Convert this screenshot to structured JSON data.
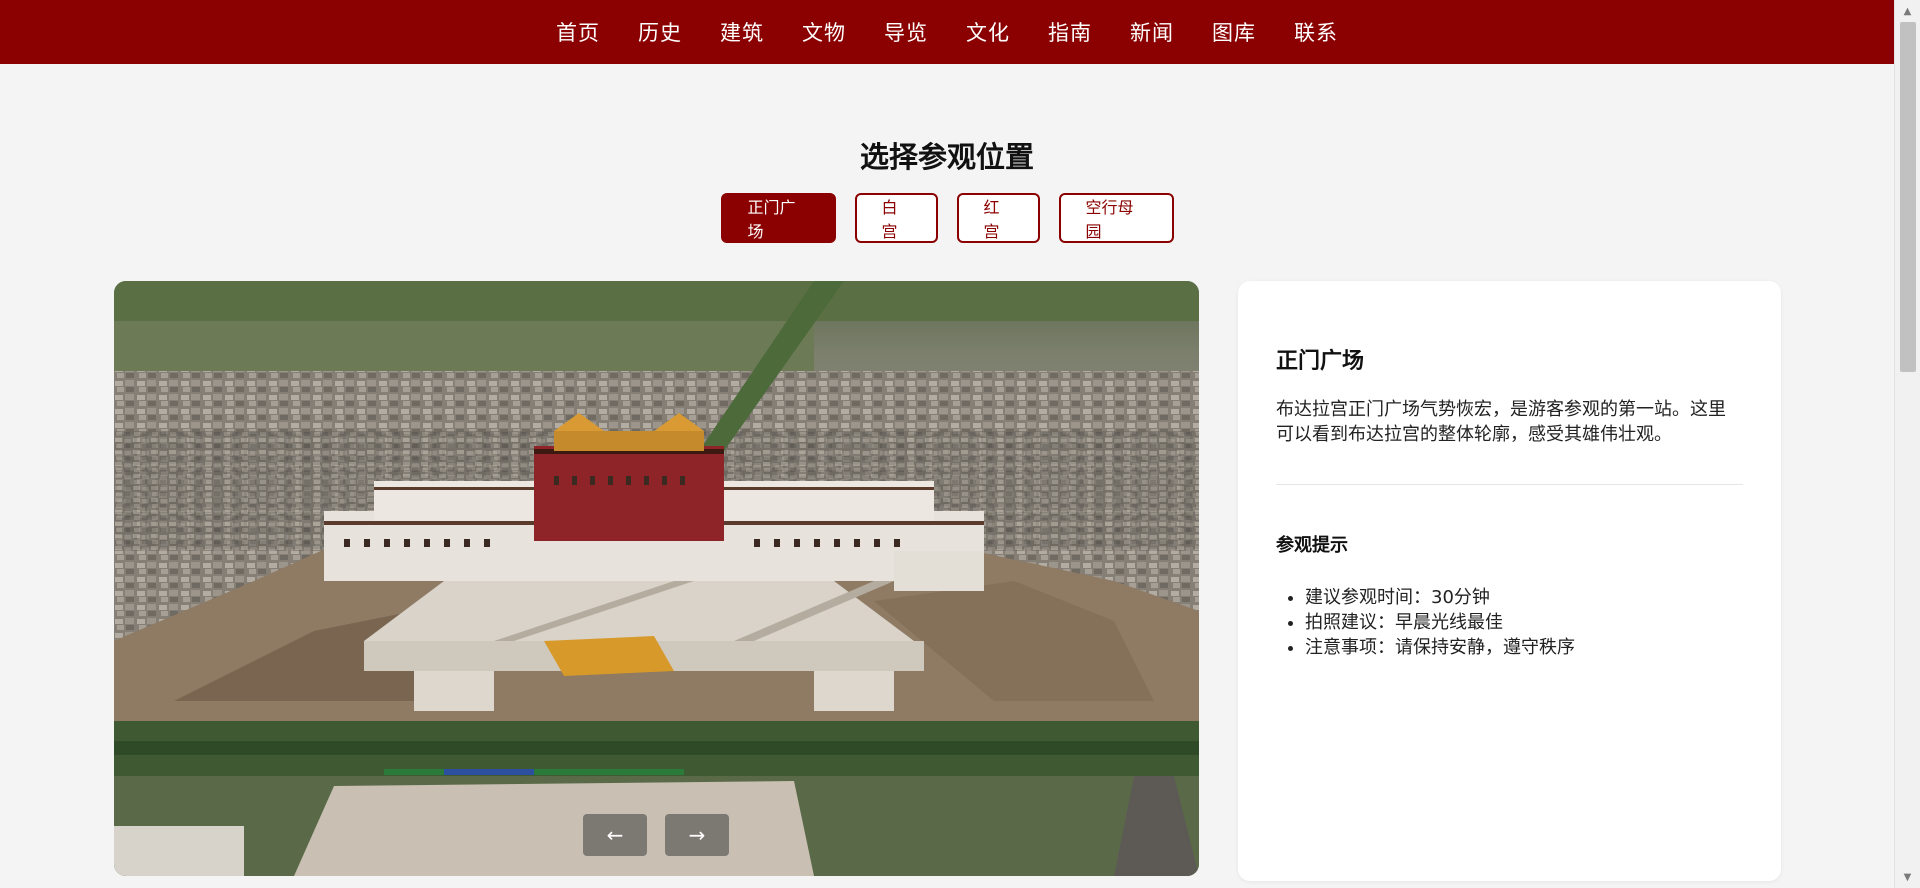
{
  "nav": {
    "items": [
      "首页",
      "历史",
      "建筑",
      "文物",
      "导览",
      "文化",
      "指南",
      "新闻",
      "图库",
      "联系"
    ]
  },
  "section": {
    "title": "选择参观位置",
    "tabs": [
      "正门广场",
      "白宫",
      "红宫",
      "空行母园"
    ],
    "active_tab": "正门广场"
  },
  "viewer": {
    "prev_label": "←",
    "next_label": "→"
  },
  "info": {
    "title": "正门广场",
    "description": "布达拉宫正门广场气势恢宏，是游客参观的第一站。这里可以看到布达拉宫的整体轮廓，感受其雄伟壮观。",
    "tips_title": "参观提示",
    "tips": [
      "建议参观时间：30分钟",
      "拍照建议：早晨光线最佳",
      "注意事项：请保持安静，遵守秩序"
    ]
  },
  "colors": {
    "brand": "#8b0000",
    "background": "#f4f4f4",
    "card": "#ffffff"
  },
  "icons": {
    "scroll_up": "triangle-up-icon",
    "scroll_down": "triangle-down-icon"
  }
}
